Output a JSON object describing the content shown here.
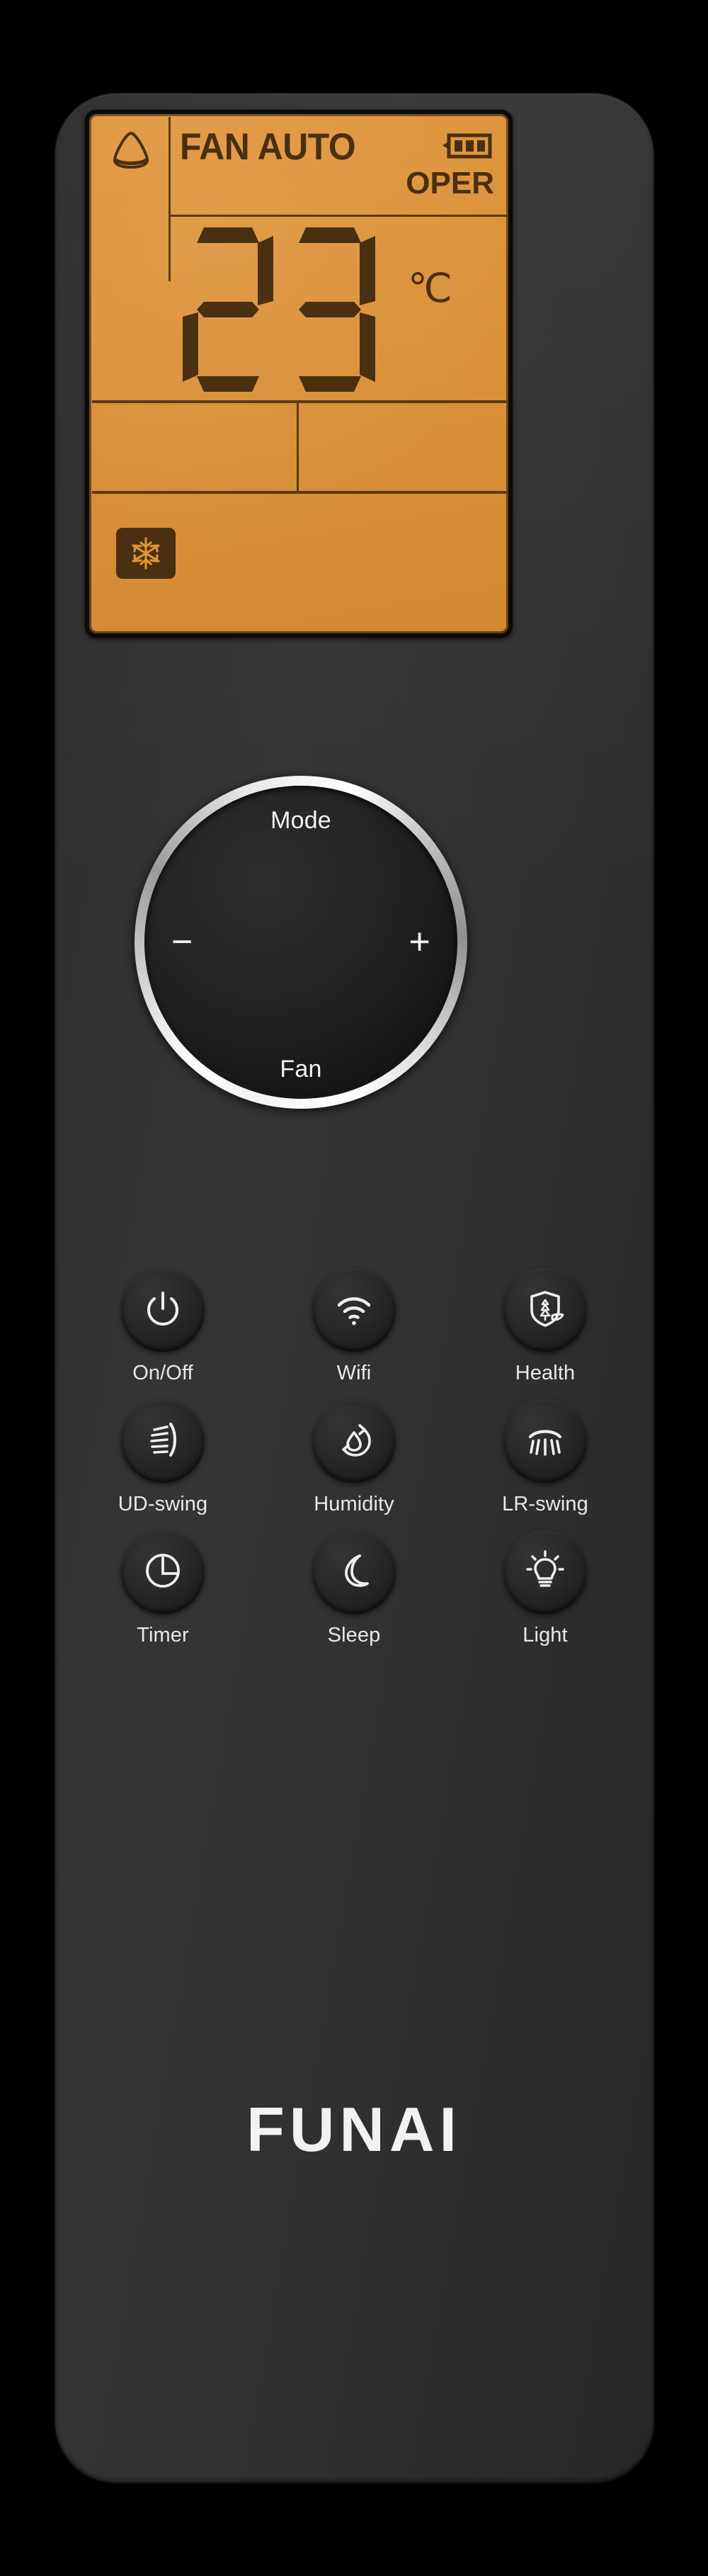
{
  "device": {
    "brand": "FUNAI",
    "type": "air-conditioner-remote"
  },
  "colors": {
    "lcd_background": "#e09236",
    "lcd_segment": "#4a2f10",
    "body": "#303030",
    "label_text": "#e9e9e9",
    "ring_chrome": "#ffffff"
  },
  "lcd": {
    "mode_indicator_icon": "signal-triangle-icon",
    "fan_label": "FAN AUTO",
    "battery_icon": "battery-full-icon",
    "battery_bars": 3,
    "operation_label": "OPER",
    "temperature": "23",
    "temperature_digits": [
      "2",
      "3"
    ],
    "unit": "℃",
    "mode_icon": "snowflake-icon",
    "mode_icon_active": true
  },
  "wheel": {
    "top_label": "Mode",
    "bottom_label": "Fan",
    "left_label": "−",
    "right_label": "+",
    "left_icon": "minus-icon",
    "right_icon": "plus-icon"
  },
  "buttons": [
    [
      {
        "label": "On/Off",
        "icon": "power-icon"
      },
      {
        "label": "Wifi",
        "icon": "wifi-icon"
      },
      {
        "label": "Health",
        "icon": "shield-leaf-icon"
      }
    ],
    [
      {
        "label": "UD-swing",
        "icon": "up-down-swing-icon"
      },
      {
        "label": "Humidity",
        "icon": "water-drop-cycle-icon"
      },
      {
        "label": "LR-swing",
        "icon": "left-right-swing-icon"
      }
    ],
    [
      {
        "label": "Timer",
        "icon": "clock-icon"
      },
      {
        "label": "Sleep",
        "icon": "moon-icon"
      },
      {
        "label": "Light",
        "icon": "lightbulb-icon"
      }
    ]
  ]
}
